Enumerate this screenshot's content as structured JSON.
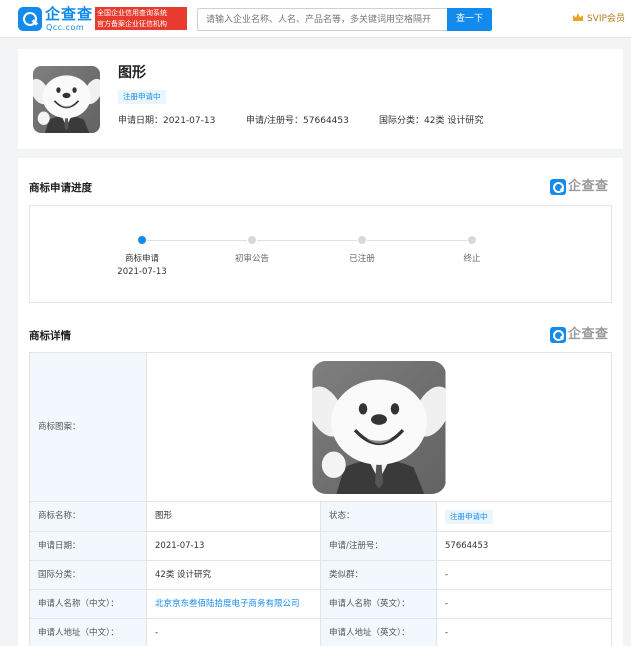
{
  "header": {
    "logo_name": "企查查",
    "logo_domain": "Qcc.com",
    "logo_tag_line1": "全国企业信用查询系统",
    "logo_tag_line2": "官方备案企业征信机构",
    "search_placeholder": "请输入企业名称、人名、产品名等，多关键词用空格隔开",
    "search_button": "查一下",
    "vip_label": "SVIP会员"
  },
  "trademark": {
    "name": "图形",
    "status": "注册申请中",
    "apply_date_label": "申请日期：",
    "apply_date": "2021-07-13",
    "reg_no_label": "申请/注册号：",
    "reg_no": "57664453",
    "intl_class_label": "国际分类：",
    "intl_class": "42类 设计研究"
  },
  "progress": {
    "title": "商标申请进度",
    "steps": [
      {
        "label": "商标申请",
        "date": "2021-07-13",
        "active": true
      },
      {
        "label": "初审公告",
        "date": "",
        "active": false
      },
      {
        "label": "已注册",
        "date": "",
        "active": false
      },
      {
        "label": "终止",
        "date": "",
        "active": false
      }
    ]
  },
  "qcc_mark": "企查查",
  "details": {
    "title": "商标详情",
    "image_label": "商标图案：",
    "rows": [
      {
        "l1": "商标名称：",
        "v1": "图形",
        "l2": "状态：",
        "v2": "注册申请中"
      },
      {
        "l1": "申请日期：",
        "v1": "2021-07-13",
        "l2": "申请/注册号：",
        "v2": "57664453"
      },
      {
        "l1": "国际分类：",
        "v1": "42类 设计研究",
        "l2": "类似群：",
        "v2": "-"
      },
      {
        "l1": "申请人名称（中文）：",
        "v1": "北京京东叁佰陆拾度电子商务有限公司",
        "l2": "申请人名称（英文）：",
        "v2": "-"
      },
      {
        "l1": "申请人地址（中文）：",
        "v1": "-",
        "l2": "申请人地址（英文）：",
        "v2": "-"
      }
    ]
  },
  "colors": {
    "brand_blue": "#128bed",
    "tag_red": "#e63b2e",
    "label_bg": "#f2f8fe",
    "vip_gold": "#b07b1f"
  }
}
